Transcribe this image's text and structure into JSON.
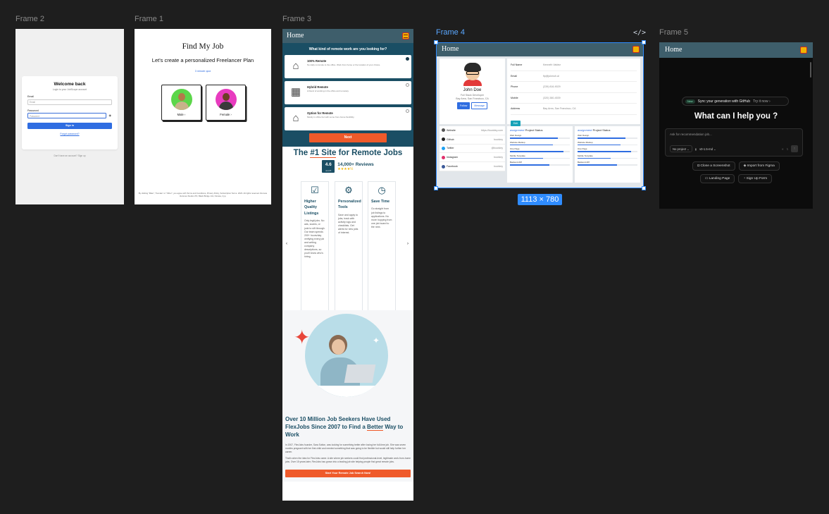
{
  "canvas": {
    "frames": [
      {
        "label": "Frame 2"
      },
      {
        "label": "Frame 1"
      },
      {
        "label": "Frame 3"
      },
      {
        "label": "Frame 4"
      },
      {
        "label": "Frame 5"
      }
    ],
    "selection_size": "1113 × 780",
    "code_icon": "</>",
    "colors": {
      "selection": "#2f8cff",
      "canvas_bg": "#1e1e1e"
    }
  },
  "frame2": {
    "title": "Welcome back",
    "subtitle": "Login to your JobScope account",
    "email_label": "Email",
    "email_placeholder": "Email",
    "password_label": "Password",
    "password_placeholder": "Password",
    "signin_label": "Sign in",
    "forgot_label": "Forgot password?",
    "footer_text": "Don't have an account? Sign up"
  },
  "frame1": {
    "title": "Find My Job",
    "subtitle": "Let's create a personalized Freelancer Plan",
    "quiz_link": "3 minute quiz",
    "male_label": "Male  ›",
    "female_label": "Female  ›",
    "legal": "By clicking \"Male\", \"Female\" or \"Other\", you agree with Terms and Conditions, Privacy Policy, Subscription Terms. 2023. All rights reserved. Remote Ventures Studio LTD, Black Bridge 141, Nicosia, Cyp."
  },
  "frame3": {
    "header_title": "Home",
    "question": "What kind of remote work are you looking for?",
    "options": [
      {
        "icon": "remote-icon",
        "title": "100% Remote",
        "desc": "No daily commute to the office. Work from home or the location of your choice.",
        "selected": true
      },
      {
        "icon": "hybrid-icon",
        "title": "Hybrid Remote",
        "desc": "A blend of working in the office and remotely.",
        "selected": false
      },
      {
        "icon": "option-icon",
        "title": "Option for Remote",
        "desc": "Mostly in office but with some from-home flexibility.",
        "selected": false
      }
    ],
    "next_label": "Next",
    "site_heading_pre": "The ",
    "site_heading_u": "#1 Site",
    "site_heading_post": " for Remote Jobs",
    "rating_value": "4.6",
    "rating_caption": "out of 5",
    "reviews": "14,000+ Reviews",
    "stars": "★★★★½",
    "features": [
      {
        "icon": "listing-icon",
        "title": "Higher Quality Listings",
        "desc": "Only legit jobs. No ads, scams, or junk to sift through. Our team spends 200+ hours/day verifying every job and writing company descriptions, so you'll know who's hiring."
      },
      {
        "icon": "tools-icon",
        "title": "Personalized Tools",
        "desc": "Save and apply to jobs, track with activity logs and checklists. Get alerts for new jobs of interest."
      },
      {
        "icon": "time-icon",
        "title": "Save Time",
        "desc": "Go straight from job listings to applications. No more hopping from one job board to the next."
      }
    ],
    "prev_arrow": "‹",
    "next_arrow": "›",
    "story_heading_1": "Over 10 Million Job Seekers Have Used FlexJobs Since 2007 to Find a ",
    "story_heading_u": "Better",
    "story_heading_2": " Way to Work",
    "story_p1": "In 2007, FlexJobs founder, Sara Sutton, was looking for something better after losing her full-time job. She was seven months pregnant with her first child and needed something that was going to be flexible but would still help further her career.",
    "story_p2": "That's when the idea for FlexJobs came: A site where job seekers could find professional-level, legitimate work-from-home jobs. Over 15 years later, FlexJobs has grown into a leading job site helping people find great remote jobs.",
    "cta_label": "Start Your Remote Job Search Now!"
  },
  "frame4": {
    "header_title": "Home",
    "name": "John Doe",
    "role": "Full Stack Developer",
    "location": "Bay Area, San Francisco, CA",
    "follow_label": "Follow",
    "message_label": "Message",
    "details": [
      {
        "key": "Full Name",
        "value": "Kenneth Valdez"
      },
      {
        "key": "Email",
        "value": "fip@jukmuh.al"
      },
      {
        "key": "Phone",
        "value": "(239) 816-9029"
      },
      {
        "key": "Mobile",
        "value": "(320) 380-4539"
      },
      {
        "key": "Address",
        "value": "Bay Area, San Francisco, CA"
      }
    ],
    "edit_label": "Edit",
    "social": [
      {
        "label": "Website",
        "value": "https://bootdey.com",
        "color": "#555555"
      },
      {
        "label": "Github",
        "value": "bootdey",
        "color": "#222222"
      },
      {
        "label": "Twitter",
        "value": "@bootdey",
        "color": "#1da1f2"
      },
      {
        "label": "Instagram",
        "value": "bootdey",
        "color": "#e1306c"
      },
      {
        "label": "Facebook",
        "value": "bootdey",
        "color": "#3b5998"
      }
    ],
    "projects": [
      {
        "tag": "assignment",
        "title": " Project Status",
        "items": [
          {
            "label": "Web Design",
            "progress": 80
          },
          {
            "label": "Website Markup",
            "progress": 72
          },
          {
            "label": "One Page",
            "progress": 89
          },
          {
            "label": "Mobile Template",
            "progress": 55
          },
          {
            "label": "Backend API",
            "progress": 66
          }
        ]
      },
      {
        "tag": "assignment",
        "title": " Project Status",
        "items": [
          {
            "label": "Web Design",
            "progress": 80
          },
          {
            "label": "Website Markup",
            "progress": 72
          },
          {
            "label": "One Page",
            "progress": 89
          },
          {
            "label": "Mobile Template",
            "progress": 55
          },
          {
            "label": "Backend API",
            "progress": 66
          }
        ]
      }
    ]
  },
  "frame5": {
    "header_title": "Home",
    "badge": "New",
    "sync_text": "Sync your generation with GitHub",
    "try_text": "Try it now ›",
    "heading": "What can I help you ?",
    "prompt_placeholder": "Ask for recommendation job...",
    "project_chip": "No project ⌄",
    "model_chip": "v0-1.5-md ⌄",
    "buttons_row1": [
      "Clone a Screenshot",
      "Import from Figma"
    ],
    "buttons_row2": [
      "Landing Page",
      "Sign Up Form"
    ]
  }
}
